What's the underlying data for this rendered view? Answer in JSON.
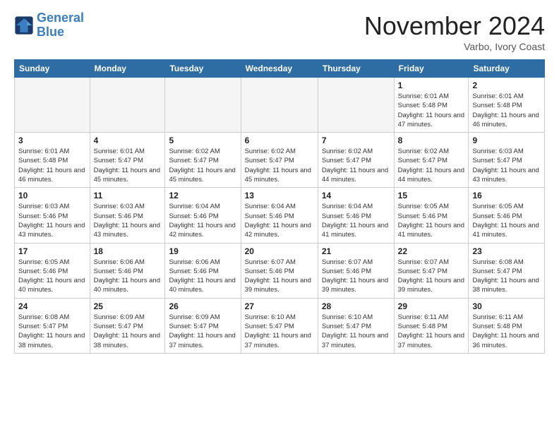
{
  "header": {
    "logo_line1": "General",
    "logo_line2": "Blue",
    "month_title": "November 2024",
    "location": "Varbo, Ivory Coast"
  },
  "weekdays": [
    "Sunday",
    "Monday",
    "Tuesday",
    "Wednesday",
    "Thursday",
    "Friday",
    "Saturday"
  ],
  "weeks": [
    [
      {
        "day": "",
        "info": ""
      },
      {
        "day": "",
        "info": ""
      },
      {
        "day": "",
        "info": ""
      },
      {
        "day": "",
        "info": ""
      },
      {
        "day": "",
        "info": ""
      },
      {
        "day": "1",
        "info": "Sunrise: 6:01 AM\nSunset: 5:48 PM\nDaylight: 11 hours\nand 47 minutes."
      },
      {
        "day": "2",
        "info": "Sunrise: 6:01 AM\nSunset: 5:48 PM\nDaylight: 11 hours\nand 46 minutes."
      }
    ],
    [
      {
        "day": "3",
        "info": "Sunrise: 6:01 AM\nSunset: 5:48 PM\nDaylight: 11 hours\nand 46 minutes."
      },
      {
        "day": "4",
        "info": "Sunrise: 6:01 AM\nSunset: 5:47 PM\nDaylight: 11 hours\nand 45 minutes."
      },
      {
        "day": "5",
        "info": "Sunrise: 6:02 AM\nSunset: 5:47 PM\nDaylight: 11 hours\nand 45 minutes."
      },
      {
        "day": "6",
        "info": "Sunrise: 6:02 AM\nSunset: 5:47 PM\nDaylight: 11 hours\nand 45 minutes."
      },
      {
        "day": "7",
        "info": "Sunrise: 6:02 AM\nSunset: 5:47 PM\nDaylight: 11 hours\nand 44 minutes."
      },
      {
        "day": "8",
        "info": "Sunrise: 6:02 AM\nSunset: 5:47 PM\nDaylight: 11 hours\nand 44 minutes."
      },
      {
        "day": "9",
        "info": "Sunrise: 6:03 AM\nSunset: 5:47 PM\nDaylight: 11 hours\nand 43 minutes."
      }
    ],
    [
      {
        "day": "10",
        "info": "Sunrise: 6:03 AM\nSunset: 5:46 PM\nDaylight: 11 hours\nand 43 minutes."
      },
      {
        "day": "11",
        "info": "Sunrise: 6:03 AM\nSunset: 5:46 PM\nDaylight: 11 hours\nand 43 minutes."
      },
      {
        "day": "12",
        "info": "Sunrise: 6:04 AM\nSunset: 5:46 PM\nDaylight: 11 hours\nand 42 minutes."
      },
      {
        "day": "13",
        "info": "Sunrise: 6:04 AM\nSunset: 5:46 PM\nDaylight: 11 hours\nand 42 minutes."
      },
      {
        "day": "14",
        "info": "Sunrise: 6:04 AM\nSunset: 5:46 PM\nDaylight: 11 hours\nand 41 minutes."
      },
      {
        "day": "15",
        "info": "Sunrise: 6:05 AM\nSunset: 5:46 PM\nDaylight: 11 hours\nand 41 minutes."
      },
      {
        "day": "16",
        "info": "Sunrise: 6:05 AM\nSunset: 5:46 PM\nDaylight: 11 hours\nand 41 minutes."
      }
    ],
    [
      {
        "day": "17",
        "info": "Sunrise: 6:05 AM\nSunset: 5:46 PM\nDaylight: 11 hours\nand 40 minutes."
      },
      {
        "day": "18",
        "info": "Sunrise: 6:06 AM\nSunset: 5:46 PM\nDaylight: 11 hours\nand 40 minutes."
      },
      {
        "day": "19",
        "info": "Sunrise: 6:06 AM\nSunset: 5:46 PM\nDaylight: 11 hours\nand 40 minutes."
      },
      {
        "day": "20",
        "info": "Sunrise: 6:07 AM\nSunset: 5:46 PM\nDaylight: 11 hours\nand 39 minutes."
      },
      {
        "day": "21",
        "info": "Sunrise: 6:07 AM\nSunset: 5:46 PM\nDaylight: 11 hours\nand 39 minutes."
      },
      {
        "day": "22",
        "info": "Sunrise: 6:07 AM\nSunset: 5:47 PM\nDaylight: 11 hours\nand 39 minutes."
      },
      {
        "day": "23",
        "info": "Sunrise: 6:08 AM\nSunset: 5:47 PM\nDaylight: 11 hours\nand 38 minutes."
      }
    ],
    [
      {
        "day": "24",
        "info": "Sunrise: 6:08 AM\nSunset: 5:47 PM\nDaylight: 11 hours\nand 38 minutes."
      },
      {
        "day": "25",
        "info": "Sunrise: 6:09 AM\nSunset: 5:47 PM\nDaylight: 11 hours\nand 38 minutes."
      },
      {
        "day": "26",
        "info": "Sunrise: 6:09 AM\nSunset: 5:47 PM\nDaylight: 11 hours\nand 37 minutes."
      },
      {
        "day": "27",
        "info": "Sunrise: 6:10 AM\nSunset: 5:47 PM\nDaylight: 11 hours\nand 37 minutes."
      },
      {
        "day": "28",
        "info": "Sunrise: 6:10 AM\nSunset: 5:47 PM\nDaylight: 11 hours\nand 37 minutes."
      },
      {
        "day": "29",
        "info": "Sunrise: 6:11 AM\nSunset: 5:48 PM\nDaylight: 11 hours\nand 37 minutes."
      },
      {
        "day": "30",
        "info": "Sunrise: 6:11 AM\nSunset: 5:48 PM\nDaylight: 11 hours\nand 36 minutes."
      }
    ]
  ]
}
